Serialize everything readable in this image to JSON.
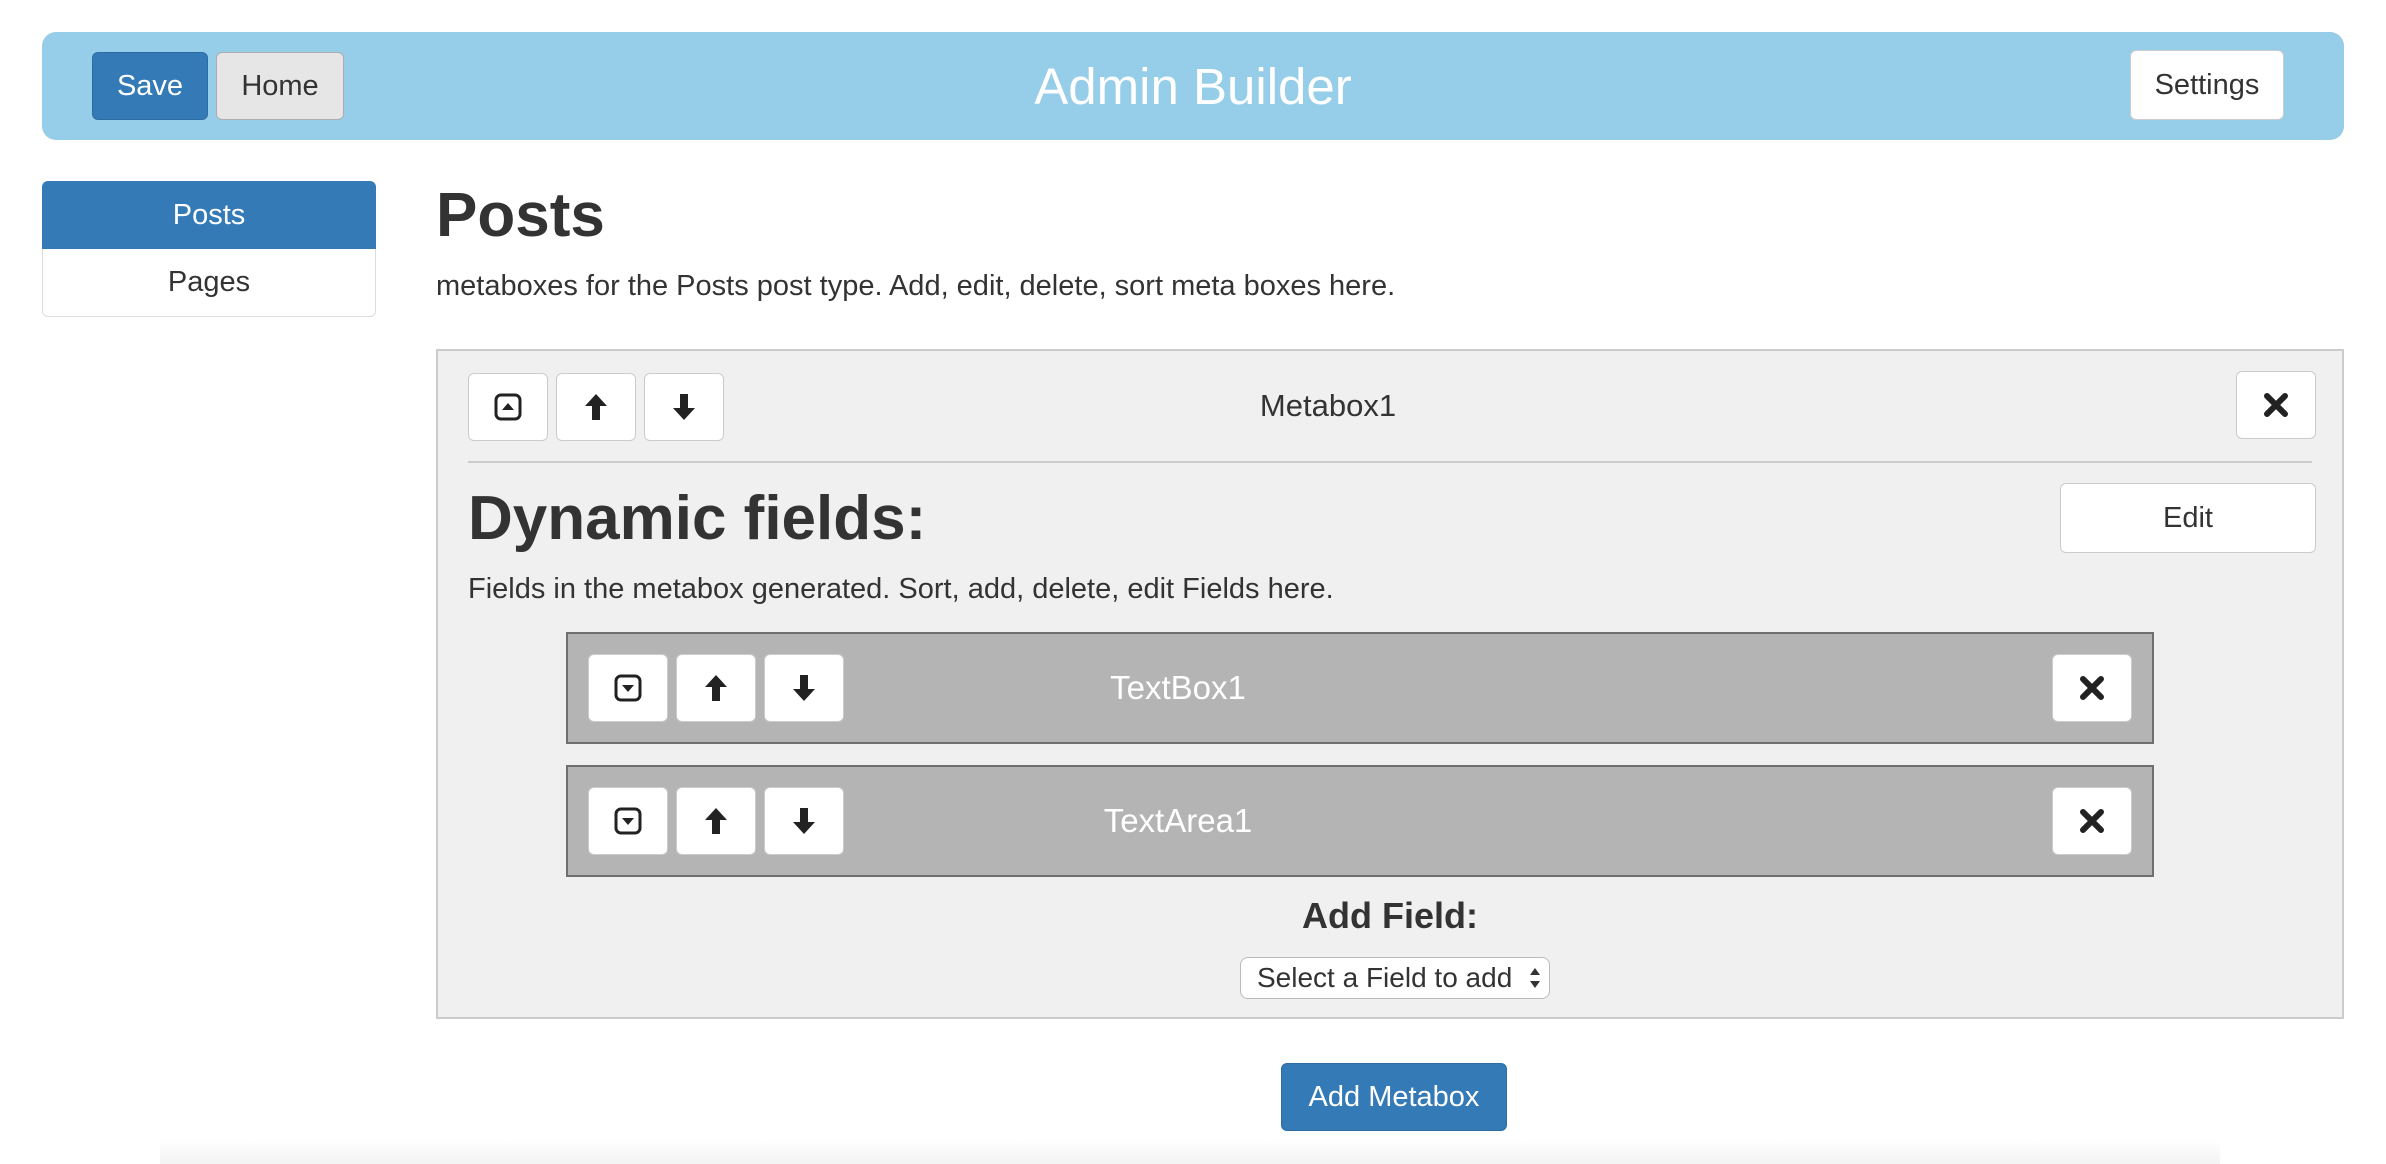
{
  "header": {
    "title": "Admin Builder",
    "save_label": "Save",
    "home_label": "Home",
    "settings_label": "Settings",
    "background_color": "#96cde8"
  },
  "sidebar": {
    "items": [
      {
        "label": "Posts",
        "active": true
      },
      {
        "label": "Pages",
        "active": false
      }
    ]
  },
  "main": {
    "title": "Posts",
    "description": "metaboxes for the Posts post type. Add, edit, delete, sort meta boxes here.",
    "metaboxes": [
      {
        "title": "Metabox1",
        "icons": [
          "collapse-up-icon",
          "arrow-up-icon",
          "arrow-down-icon",
          "close-icon"
        ],
        "dynamic_fields_heading": "Dynamic fields:",
        "edit_label": "Edit",
        "fields_description": "Fields in the metabox generated. Sort, add, delete, edit Fields here.",
        "fields": [
          {
            "label": "TextBox1",
            "icons": [
              "expand-down-icon",
              "arrow-up-icon",
              "arrow-down-icon",
              "close-icon"
            ]
          },
          {
            "label": "TextArea1",
            "icons": [
              "expand-down-icon",
              "arrow-up-icon",
              "arrow-down-icon",
              "close-icon"
            ]
          }
        ],
        "add_field_label": "Add Field:",
        "select_placeholder": "Select a Field to add"
      }
    ],
    "add_metabox_label": "Add Metabox"
  },
  "colors": {
    "primary": "#337ab7",
    "field_row_bg": "#b4b4b4",
    "metabox_bg": "#f0f0f0"
  }
}
